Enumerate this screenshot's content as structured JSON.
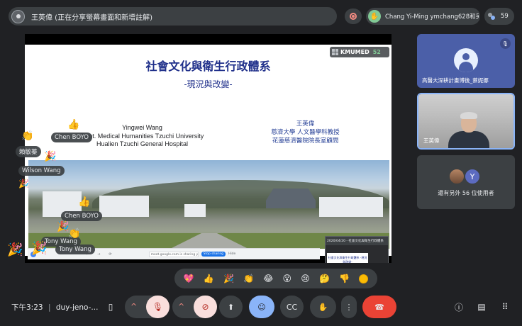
{
  "header": {
    "presenter_label": "王英偉 (正在分享螢幕畫面和新增註解)",
    "hand_raised_text": "Chang Yi-Ming ymchang628和另外",
    "participant_count": "59"
  },
  "presentation": {
    "badge_name": "KMUMED",
    "badge_count": "52",
    "title": "社會文化與衛生行政體系",
    "subtitle": "-現況與改變-",
    "en_lines": [
      "Yingwei Wang",
      "Dept. Medical Humanities Tzuchi University",
      "Hualien Tzuchi General Hospital"
    ],
    "zh_lines": [
      "王英偉",
      "慈濟大學 人文醫學科教授",
      "花蓮慈濟醫院院長室顧問"
    ],
    "mini_bar_text": "meet.google.com is sharing your screen.",
    "mini_stop": "Stop sharing",
    "mini_hide": "Hide",
    "mini_meet_title": "2020/04/20 - 社會文化與衛生行政體系",
    "mini_meet_card": "社會文化與衛生行政體系 -現況與改變-"
  },
  "reactions": [
    {
      "name": "Chen BOYO",
      "emoji": "👍"
    },
    {
      "name": "賴敏蓁",
      "emoji": "👏"
    },
    {
      "name": "Wilson Wang",
      "emoji": "🎉"
    },
    {
      "name": "Chen BOYO",
      "emoji": "👍"
    },
    {
      "name": "Tony Wang",
      "emoji": "🎉"
    },
    {
      "name": "Tony Wang",
      "emoji": "👏"
    }
  ],
  "participants": [
    {
      "name": "高醫大深耕計畫博後_蔡妮娜",
      "muted": true
    },
    {
      "name": "王英偉"
    },
    {
      "initial": "Y",
      "others_label": "還有另外 56 位使用者"
    }
  ],
  "emoji_bar": [
    "💖",
    "👍",
    "🎉",
    "👏",
    "😂",
    "😮",
    "😢",
    "🤔",
    "👎"
  ],
  "controls": {
    "time": "下午3:23",
    "meeting_code": "duy-jeno-...",
    "buttons": [
      "mic-off",
      "camera-off",
      "present",
      "reactions",
      "captions",
      "raise-hand",
      "more",
      "leave"
    ],
    "side": [
      "info",
      "chat",
      "activities"
    ]
  },
  "colors": {
    "slide_title": "#1f2f8a",
    "leave": "#ea4335",
    "active_blue": "#8ab4f8",
    "hand_green": "#81c995"
  }
}
